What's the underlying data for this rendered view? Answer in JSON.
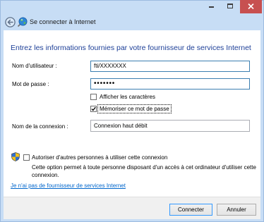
{
  "window": {
    "title": "Se connecter à Internet",
    "caption_buttons": {
      "minimize_icon": "minimize-icon",
      "maximize_icon": "maximize-icon",
      "close_icon": "close-icon"
    },
    "back_icon": "back-arrow-icon",
    "app_icon": "network-globe-icon"
  },
  "heading": "Entrez les informations fournies par votre fournisseur de services Internet",
  "form": {
    "username": {
      "label": "Nom d'utilisateur :",
      "value": "fti/XXXXXXX"
    },
    "password": {
      "label": "Mot de passe :",
      "value": "•••••••"
    },
    "show_characters": {
      "label": "Afficher les caractères",
      "checked": false
    },
    "remember_password": {
      "label": "Mémoriser ce mot de passe",
      "checked": true
    },
    "connection_name": {
      "label": "Nom de la connexion :",
      "value": "Connexion haut débit"
    }
  },
  "sharing": {
    "shield_icon": "uac-shield-icon",
    "label": "Autoriser d'autres personnes à utiliser cette connexion",
    "checked": false,
    "description": "Cette option permet à toute personne disposant d'un accès à cet ordinateur d'utiliser cette connexion."
  },
  "no_isp_link": "Je n'ai pas de fournisseur de services Internet",
  "buttons": {
    "connect": "Connecter",
    "cancel": "Annuler"
  },
  "colors": {
    "frame": "#c7ddf5",
    "close_button": "#c75050",
    "heading_text": "#1c3e97",
    "link_text": "#0066cc",
    "focus_border": "#3c7fb1",
    "command_area": "#f0f0f0"
  }
}
